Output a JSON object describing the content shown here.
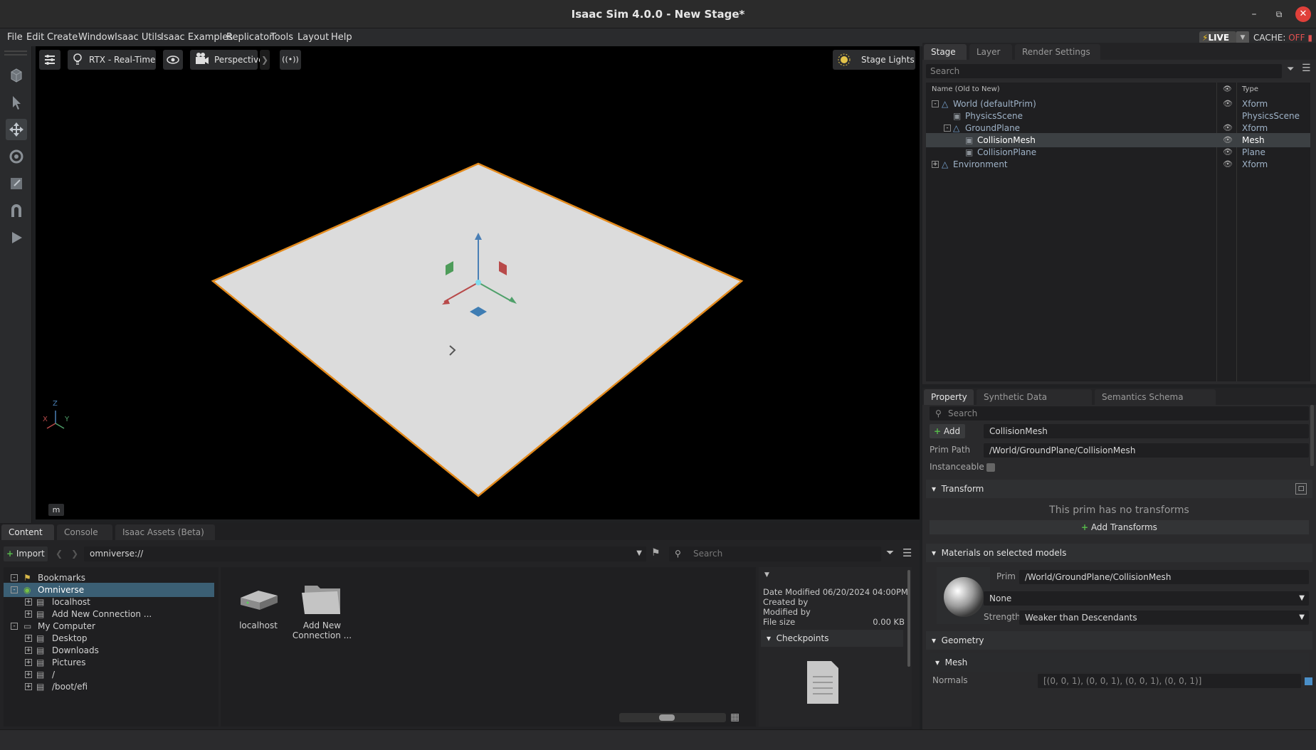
{
  "window": {
    "title": "Isaac Sim 4.0.0 - New Stage*"
  },
  "menubar": {
    "items": [
      "File",
      "Edit",
      "Create",
      "Window",
      "Isaac Utils",
      "Isaac Examples",
      "Replicator",
      "Tools",
      "Layout",
      "Help"
    ],
    "live_label": "LIVE",
    "cache_label": "CACHE:",
    "cache_state": "OFF"
  },
  "viewport": {
    "renderer_label": "RTX - Real-Time",
    "camera_label": "Perspective",
    "lights_label": "Stage Lights",
    "units_label": "m",
    "axis_labels": {
      "x": "X",
      "y": "Y",
      "z": "Z"
    }
  },
  "stage": {
    "tabs": [
      "Stage",
      "Layer",
      "Render Settings"
    ],
    "search_placeholder": "Search",
    "header_name": "Name (Old to New)",
    "header_type": "Type",
    "rows": [
      {
        "name": "World (defaultPrim)",
        "type": "Xform",
        "icon": "xform-icon",
        "expander": "-",
        "visible": true
      },
      {
        "name": "PhysicsScene",
        "type": "PhysicsScene",
        "icon": "cube-icon",
        "expander": "",
        "visible": false
      },
      {
        "name": "GroundPlane",
        "type": "Xform",
        "icon": "xform-icon",
        "expander": "-",
        "visible": true
      },
      {
        "name": "CollisionMesh",
        "type": "Mesh",
        "icon": "cube-icon",
        "expander": "",
        "visible": true,
        "selected": true
      },
      {
        "name": "CollisionPlane",
        "type": "Plane",
        "icon": "cube-icon",
        "expander": "",
        "visible": true
      },
      {
        "name": "Environment",
        "type": "Xform",
        "icon": "xform-icon",
        "expander": "+",
        "visible": true
      }
    ]
  },
  "property": {
    "tabs": [
      "Property",
      "Synthetic Data Recorder",
      "Semantics Schema Editor"
    ],
    "search_placeholder": "Search",
    "add_label": "Add",
    "prim_name": "CollisionMesh",
    "prim_path_label": "Prim Path",
    "prim_path": "/World/GroundPlane/CollisionMesh",
    "instanceable_label": "Instanceable",
    "transform": {
      "title": "Transform",
      "message": "This prim has no transforms",
      "add_label": "Add Transforms"
    },
    "materials": {
      "title": "Materials on selected models",
      "prim_label": "Prim",
      "prim_value": "/World/GroundPlane/CollisionMesh",
      "material_value": "None",
      "strength_label": "Strength",
      "strength_value": "Weaker than Descendants"
    },
    "geometry": {
      "title": "Geometry",
      "mesh_title": "Mesh",
      "normals_label": "Normals",
      "normals_value": "[(0, 0, 1), (0, 0, 1), (0, 0, 1), (0, 0, 1)]"
    }
  },
  "content": {
    "tabs": [
      "Content",
      "Console",
      "Isaac Assets (Beta)"
    ],
    "import_label": "Import",
    "path_value": "omniverse://",
    "search_placeholder": "Search",
    "tree": [
      {
        "label": "Bookmarks",
        "indent": 0,
        "icon": "bookmark-icon",
        "exp": "-"
      },
      {
        "label": "Omniverse",
        "indent": 0,
        "icon": "omniverse-icon",
        "exp": "-",
        "selected": true
      },
      {
        "label": "localhost",
        "indent": 1,
        "icon": "drive-icon",
        "exp": "+"
      },
      {
        "label": "Add New Connection ...",
        "indent": 1,
        "icon": "drive-icon",
        "exp": "+"
      },
      {
        "label": "My Computer",
        "indent": 0,
        "icon": "computer-icon",
        "exp": "-"
      },
      {
        "label": "Desktop",
        "indent": 1,
        "icon": "drive-icon",
        "exp": "+"
      },
      {
        "label": "Downloads",
        "indent": 1,
        "icon": "drive-icon",
        "exp": "+"
      },
      {
        "label": "Pictures",
        "indent": 1,
        "icon": "drive-icon",
        "exp": "+"
      },
      {
        "label": "/",
        "indent": 1,
        "icon": "drive-icon",
        "exp": "+"
      },
      {
        "label": "/boot/efi",
        "indent": 1,
        "icon": "drive-icon",
        "exp": "+"
      }
    ],
    "grid_items": [
      {
        "label": "localhost",
        "icon": "server-icon"
      },
      {
        "label": "Add New Connection ...",
        "icon": "folder-icon"
      }
    ],
    "details": {
      "date_modified": "Date Modified 06/20/2024 04:00PM",
      "created_by": "Created by",
      "modified_by": "Modified by",
      "file_size_label": "File size",
      "file_size_value": "0.00 KB",
      "checkpoints_label": "Checkpoints"
    }
  }
}
